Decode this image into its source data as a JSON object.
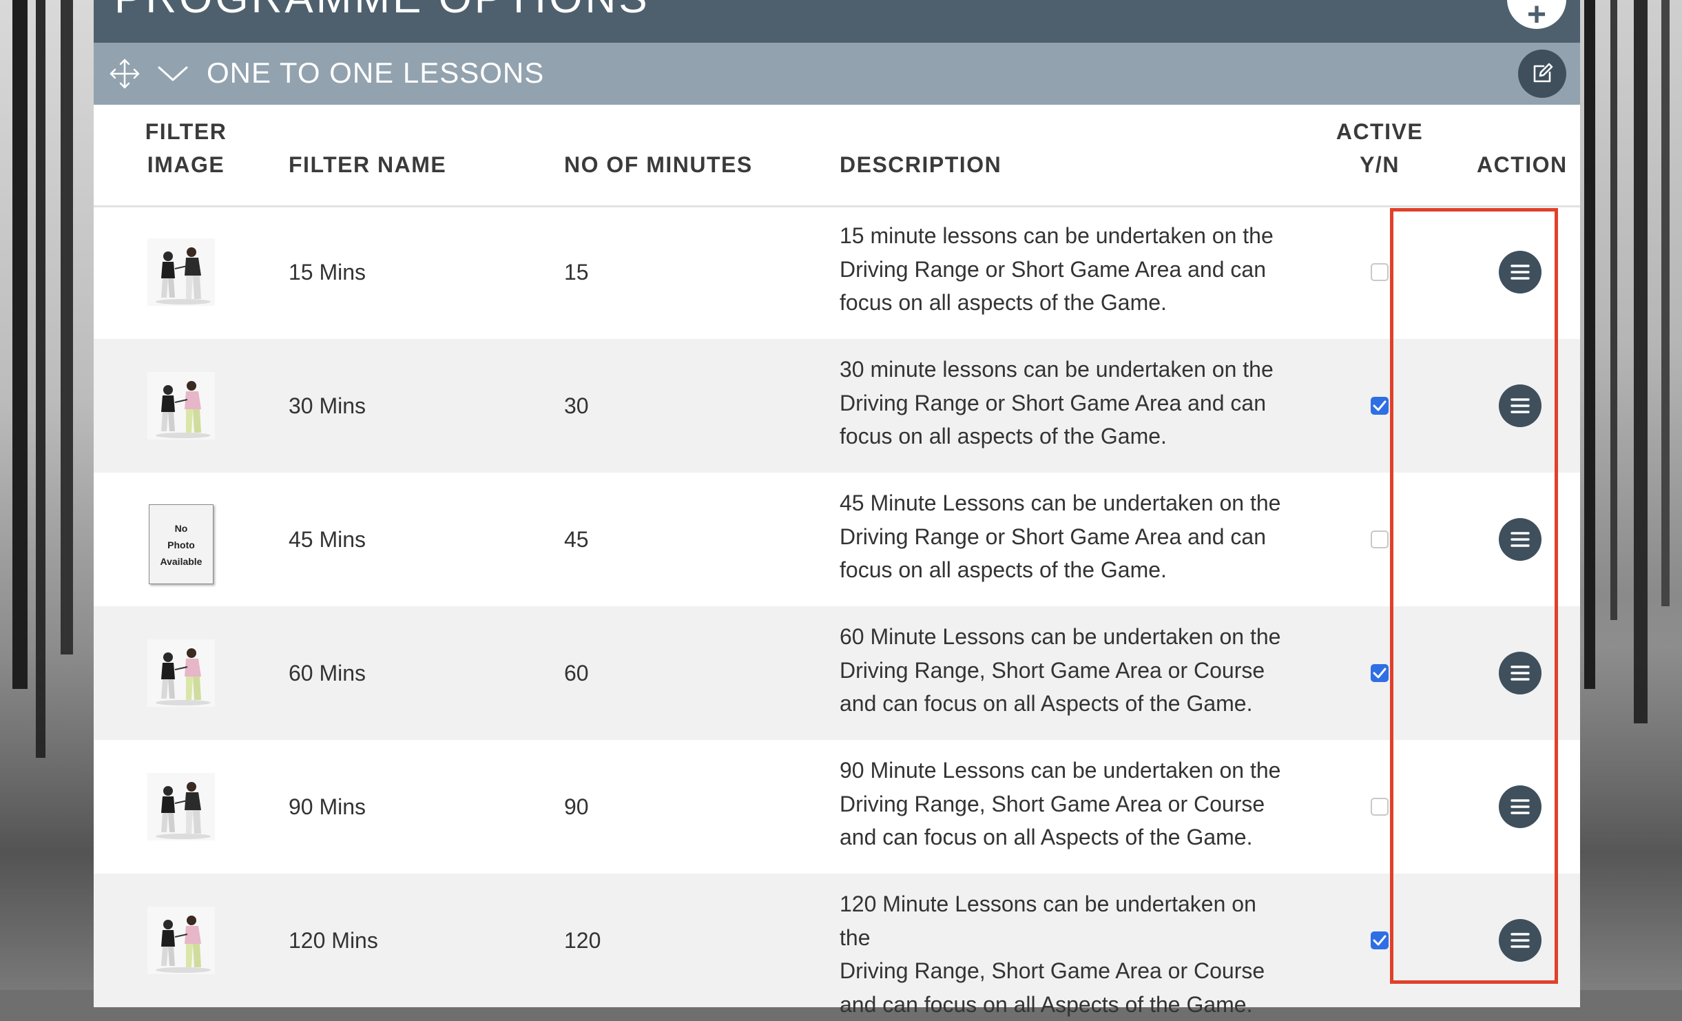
{
  "header": {
    "title": "PROGRAMME OPTIONS",
    "add_icon": "plus-icon"
  },
  "section": {
    "title": "ONE TO ONE LESSONS",
    "move_icon": "move-arrows-icon",
    "collapse_icon": "chevron-down-icon",
    "edit_icon": "edit-icon"
  },
  "table": {
    "columns": {
      "filter_image_l1": "FILTER",
      "filter_image_l2": "IMAGE",
      "filter_name": "FILTER NAME",
      "minutes": "NO OF MINUTES",
      "description": "DESCRIPTION",
      "active_l1": "ACTIVE",
      "active_l2": "Y/N",
      "action": "ACTION"
    },
    "rows": [
      {
        "image": "golf-lesson-photo",
        "name": "15 Mins",
        "minutes": "15",
        "desc_l1": "15 minute lessons can be undertaken on the",
        "desc_l2": "Driving Range or Short Game Area and can",
        "desc_l3": "focus on all aspects of the Game.",
        "active": false
      },
      {
        "image": "golf-lesson-photo",
        "name": "30 Mins",
        "minutes": "30",
        "desc_l1": "30 minute lessons can be undertaken on the",
        "desc_l2": "Driving Range or Short Game Area and can",
        "desc_l3": "focus on all aspects of the Game.",
        "active": true
      },
      {
        "image": "no-photo-placeholder",
        "no_photo_l1": "No",
        "no_photo_l2": "Photo",
        "no_photo_l3": "Available",
        "name": "45 Mins",
        "minutes": "45",
        "desc_l1": "45 Minute Lessons can be undertaken on the",
        "desc_l2": "Driving Range or Short Game Area and can",
        "desc_l3": "focus on all aspects of the Game.",
        "active": false
      },
      {
        "image": "golf-lesson-photo",
        "name": "60 Mins",
        "minutes": "60",
        "desc_l1": "60 Minute Lessons can be undertaken on the",
        "desc_l2": "Driving Range, Short Game Area or Course",
        "desc_l3": "and can focus on all Aspects of the Game.",
        "active": true
      },
      {
        "image": "golf-lesson-photo",
        "name": "90 Mins",
        "minutes": "90",
        "desc_l1": "90 Minute Lessons can be undertaken on the",
        "desc_l2": "Driving Range, Short Game Area or Course",
        "desc_l3": "and can focus on all Aspects of the Game.",
        "active": false
      },
      {
        "image": "golf-lesson-photo",
        "name": "120 Mins",
        "minutes": "120",
        "desc_l1": "120 Minute Lessons can be undertaken on the",
        "desc_l2": "Driving Range, Short Game Area or Course",
        "desc_l3": "and can focus on all Aspects of the Game.",
        "active": true
      }
    ],
    "action_icon": "menu-lines-icon"
  },
  "annotation": {
    "highlight_color": "#e0412a"
  },
  "colors": {
    "titlebar": "#4e606d",
    "sectionbar": "#92a2ae",
    "checkbox_on": "#2f6fe4",
    "action_button": "#3f4f5c"
  }
}
